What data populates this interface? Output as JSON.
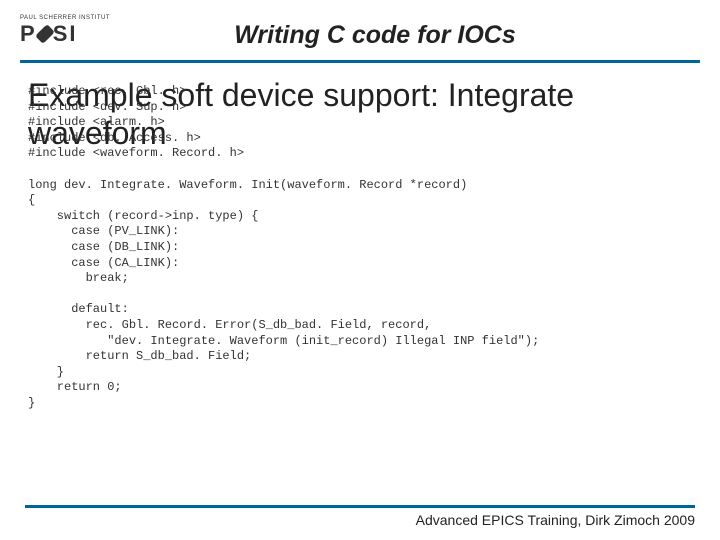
{
  "logo": {
    "top_text": "PAUL SCHERRER INSTITUT",
    "brand": "PSI"
  },
  "title": "Writing C code for IOCs",
  "subtitle_line1": "Example soft device support: Integrate",
  "subtitle_line2": "waveform",
  "code": "#include <rec. Gbl. h>\n#include <dev. Sup. h>\n#include <alarm. h>\n#include <db. Access. h>\n#include <waveform. Record. h>\n\nlong dev. Integrate. Waveform. Init(waveform. Record *record)\n{\n    switch (record->inp. type) {\n      case (PV_LINK):\n      case (DB_LINK):\n      case (CA_LINK):\n        break;\n\n      default:\n        rec. Gbl. Record. Error(S_db_bad. Field, record,\n           \"dev. Integrate. Waveform (init_record) Illegal INP field\");\n        return S_db_bad. Field;\n    }\n    return 0;\n}",
  "footer": "Advanced EPICS Training, Dirk Zimoch 2009"
}
